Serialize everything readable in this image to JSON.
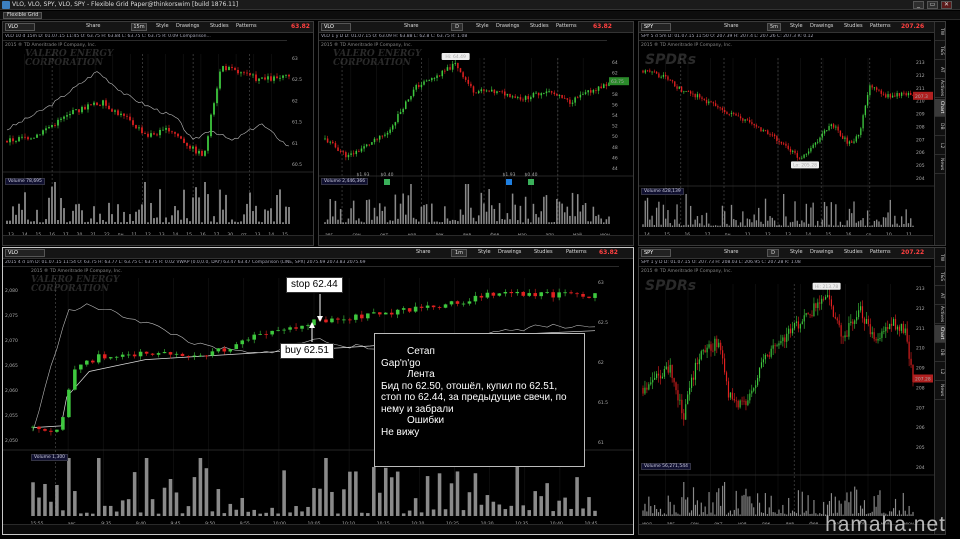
{
  "titlebar": {
    "title": "VLO, VLO, SPY, VLO, SPY - Flexible Grid Paper@thinkorswim [build 1876.11]",
    "min": "_",
    "max": "▭",
    "close": "✕"
  },
  "layout": {
    "tab": "Flexible Grid"
  },
  "toolbar": {
    "share": "Share",
    "style": "Style",
    "drawings": "Drawings",
    "studies": "Studies",
    "patterns": "Patterns"
  },
  "right_tabs": [
    "TW",
    "T&S",
    "AT",
    "Actives",
    "Chart",
    "DB",
    "L2",
    "News"
  ],
  "p1": {
    "symbol": "VLO",
    "agg": "15m",
    "price": "63.82",
    "info": "VLO 10 d 15m  D: 01.07.15 11:45  O: 63.75  H: 63.84  L: 63.75  C: 63.75  R: 0.09  Comparison...",
    "copy": "2015 ® TD Ameritrade IP Company, Inc.",
    "wm1": "VALERO ENERGY",
    "wm2": "CORPORATION",
    "vol": "Volume  78,695",
    "axis": [
      "2,080",
      "2,070",
      "2,060",
      "2,050"
    ],
    "lastlbl": "2,068.75",
    "raxis": [
      "63",
      "62.5",
      "62",
      "61.5",
      "61",
      "60.5"
    ],
    "dates": [
      "13",
      "14",
      "15",
      "16",
      "17",
      "20",
      "21",
      "22",
      "пн",
      "11",
      "12",
      "13",
      "14",
      "15",
      "16",
      "17",
      "30",
      "пт",
      "13",
      "14",
      "15"
    ]
  },
  "p2": {
    "symbol": "VLO",
    "agg": "D",
    "price": "63.82",
    "info": "VLO 1 y D  D: 01.07.15  O: 63.09  H: 63.88  L: 62.8  C: 63.75  R: 1.08",
    "copy": "2015 ® TD Ameritrade IP Company, Inc.",
    "wm1": "VALERO ENERGY",
    "wm2": "CORPORATION",
    "hi": "Hi: 64.49",
    "vol": "Volume  2,446,366",
    "last": "63.75",
    "e1": "$1.93",
    "e2": "$0.40",
    "e3": "$1.93",
    "e4": "$0.40",
    "dates": [
      "авг",
      "сен",
      "окт",
      "ноя",
      "дек",
      "янв",
      "фев",
      "мар",
      "апр",
      "май",
      "июн"
    ],
    "raxis": [
      "64",
      "62",
      "60",
      "58",
      "56",
      "54",
      "52",
      "50",
      "48",
      "46",
      "44"
    ]
  },
  "p3": {
    "symbol": "SPY",
    "agg": "5m",
    "price": "207.26",
    "info": "SPY 5 d 5m  D: 01.07.15 11:50  O: 207.39  H: 207.4  L: 207.26  C: 207.3  R: 0.12",
    "copy": "2015 ® TD Ameritrade IP Company, Inc.",
    "wm": "SPDRs",
    "lo": "Lo: 205.28",
    "vol": "Volume  428,139",
    "last": "207.3",
    "raxis": [
      "213",
      "212",
      "211",
      "210",
      "209",
      "208",
      "207",
      "206",
      "205",
      "204"
    ],
    "dates": [
      "14",
      "15",
      "16",
      "17",
      "пн",
      "11",
      "12",
      "13",
      "14",
      "15",
      "16",
      "ср",
      "10",
      "11"
    ]
  },
  "p4": {
    "symbol": "VLO",
    "agg": "1m",
    "price": "63.82",
    "info": "2015 4 d 1m  D: 01.07.15 11:54  O: 63.75  H: 63.77  L: 63.75  C: 63.75  R: 0.02  VWAP (0.0,0.0, DAY)  63.47  63.47  Comparison (LINE, SPX)  2075.69  2073.83  2075.69",
    "copy": "2015 ® TD Ameritrade IP Company, Inc.",
    "wm1": "VALERO ENERGY",
    "wm2": "CORPORATION",
    "vol": "Volume  1,300",
    "raxis": [
      "63",
      "62.5",
      "62",
      "61.5",
      "61"
    ],
    "laxis": [
      "2,080",
      "2,075",
      "2,070",
      "2,065",
      "2,060",
      "2,055",
      "2,050"
    ],
    "times": [
      "15:55",
      "авг",
      "9:35",
      "9:40",
      "9:45",
      "9:50",
      "9:55",
      "10:00",
      "10:05",
      "10:10",
      "10:15",
      "10:20",
      "10:25",
      "10:30",
      "10:35",
      "10:40",
      "10:45"
    ]
  },
  "p5": {
    "symbol": "SPY",
    "agg": "D",
    "price": "207.22",
    "info": "SPY 1 y D  D: 01.07.15  O: 207.73  H: 208.03  L: 206.95  C: 207.28  R: 1.08",
    "copy": "2015 ® TD Ameritrade IP Company, Inc.",
    "wm": "SPDRs",
    "hi": "Hi: 213.78",
    "vol": "Volume  56,271,544",
    "last": "207.28",
    "raxis": [
      "213",
      "212",
      "211",
      "210",
      "209",
      "208",
      "207",
      "206",
      "205",
      "204"
    ],
    "dates": [
      "июл",
      "авг",
      "сен",
      "окт",
      "ноя",
      "дек",
      "янв",
      "фев",
      "мар",
      "апр",
      "май",
      "июн"
    ]
  },
  "annotations": {
    "stop": "stop 62.44",
    "buy": "buy 62.51"
  },
  "setup": {
    "h1": "Сетап",
    "l1": "Gap'n'go",
    "h2": "Лента",
    "l2": "Бид по 62.50, отошёл, купил по 62.51, стоп по 62.44, за предыдущие свечи, по нему и забрали",
    "h3": "Ошибки",
    "l3": "Не вижу"
  },
  "site": "hamaha.net",
  "colors": {
    "up": "#3ec83e",
    "down": "#e02020",
    "bg": "#000000",
    "accent": "#ff4040"
  }
}
